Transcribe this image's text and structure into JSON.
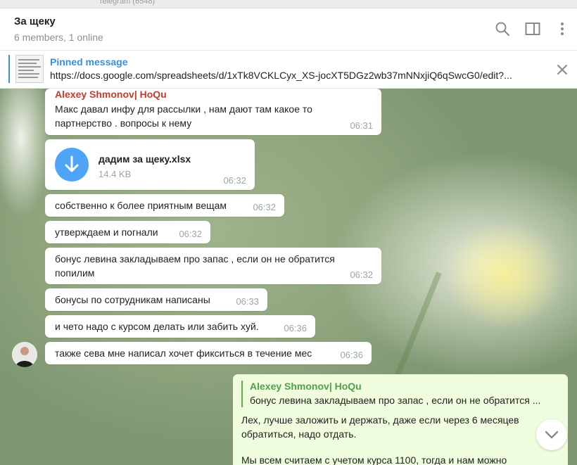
{
  "window": {
    "app_title": "Telegram (6548)"
  },
  "header": {
    "title": "За щеку",
    "status": "6 members, 1 online",
    "icons": [
      "search-icon",
      "sidebar-toggle-icon",
      "more-vertical-icon"
    ]
  },
  "pinned": {
    "label": "Pinned message",
    "text": "https://docs.google.com/spreadsheets/d/1xTk8VCKLCyx_XS-jocXT5DGz2wb37mNNxjiQ6qSwcG0/edit?..."
  },
  "messages": [
    {
      "author": "Alexey Shmonov| HoQu",
      "line1": "Макс давал инфу для рассылки , нам дают там какое то",
      "line2": "партнерство . вопросы к нему",
      "time": "06:31"
    },
    {
      "file_name": "дадим за щеку.xlsx",
      "file_size": "14.4 KB",
      "time": "06:32"
    },
    {
      "text": "собственно к более приятным вещам",
      "time": "06:32"
    },
    {
      "text": "утверждаем и погнали",
      "time": "06:32"
    },
    {
      "line1": "бонус левина закладываем про запас , если он не обратится",
      "line2": "попилим",
      "time": "06:32"
    },
    {
      "text": "бонусы по сотрудникам написаны",
      "time": "06:33"
    },
    {
      "text": "и чето надо с курсом делать или забить хуй.",
      "time": "06:36"
    },
    {
      "text": "также сева мне написал хочет фикситься в течение мес",
      "time": "06:36"
    }
  ],
  "reply": {
    "quote_author": "Alexey Shmonov| HoQu",
    "quote_text": "бонус левина закладываем про запас , если он не обратится ...",
    "line1": "Лех, лучше заложить и держать, даже если через 6 месяцев",
    "line2": "обратиться, надо отдать.",
    "line3": "Мы всем считаем с учетом курса 1100, тогда и нам можно"
  },
  "colors": {
    "accent": "#3a8fd6",
    "author_red": "#c03d33",
    "reply_green": "#4ea24b",
    "outgoing_bubble": "#effdde",
    "file_icon": "#4ea4f6"
  }
}
